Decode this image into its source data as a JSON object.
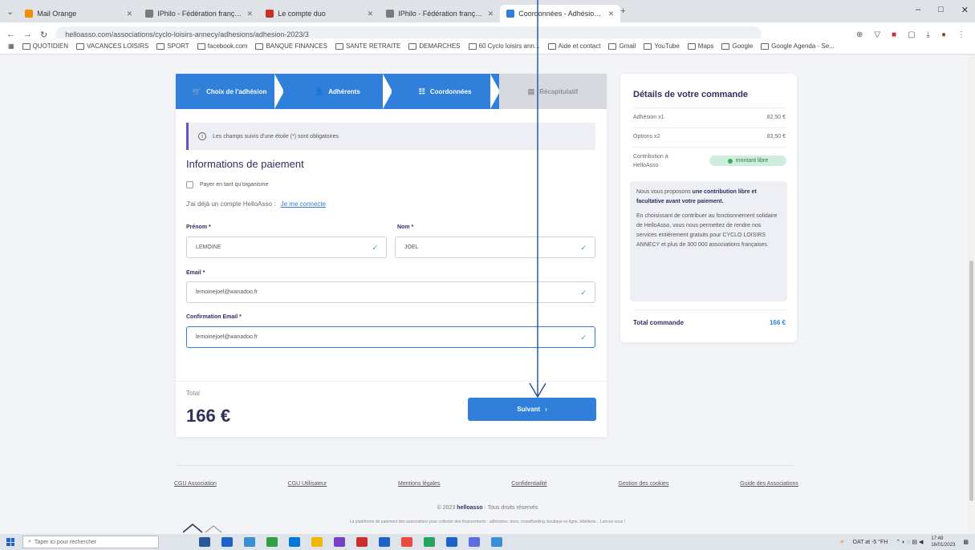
{
  "browser": {
    "tabs": [
      {
        "label": "Mail Orange",
        "color": "#f28c00",
        "active": false
      },
      {
        "label": "IPhilo - Fédération française...",
        "color": "#7a7a7a",
        "active": false
      },
      {
        "label": "Le compte duo",
        "color": "#c9302c",
        "active": false
      },
      {
        "label": "IPhilo - Fédération française...",
        "color": "#7a7a7a",
        "active": false
      },
      {
        "label": "Coordonnées - Adhésion 2023",
        "color": "#2f7fdb",
        "active": true
      }
    ],
    "new_tab": "+",
    "url": "helloasso.com/associations/cyclo-loisirs-annecy/adhesions/adhesion-2023/3",
    "bookmarks": [
      "QUOTIDIEN",
      "VACANCES LOISIRS",
      "SPORT",
      "facebook.com",
      "BANQUE FINANCES",
      "SANTE RETRAITE",
      "DEMARCHES",
      "60 Cyclo loisirs ann...",
      "Aide et contact",
      "Gmail",
      "YouTube",
      "Maps",
      "Google",
      "Google Agenda - Se..."
    ]
  },
  "stepper": {
    "steps": [
      {
        "label": "Choix de l'adhésion",
        "icon": "🛒",
        "state": "done"
      },
      {
        "label": "Adhérents",
        "icon": "👤",
        "state": "done"
      },
      {
        "label": "Coordonnées",
        "icon": "☷",
        "state": "current"
      },
      {
        "label": "Récapitulatif",
        "icon": "▤",
        "state": "future"
      }
    ]
  },
  "form": {
    "notice": "Les champs suivis d'une étoile (*) sont obligatoires",
    "section_title": "Informations de paiement",
    "pay_as_org": "Payer en tant qu'organisme",
    "account_prompt": "J'ai déjà un compte HelloAsso :",
    "login_link": "Je me connecte",
    "prenom_label": "Prénom *",
    "prenom_value": "LEMOINE",
    "nom_label": "Nom *",
    "nom_value": "JOEL",
    "email_label": "Email *",
    "email_value": "lemoinejoel@wanadoo.fr",
    "confirm_label": "Confirmation Email *",
    "confirm_value": "lemoinejoel@wanadoo.fr"
  },
  "total": {
    "label": "Total",
    "value": "166 €",
    "next_button": "Suivant"
  },
  "sidebar": {
    "title": "Détails de votre commande",
    "rows": [
      {
        "label": "Adhésion x1",
        "value": "82,50 €"
      },
      {
        "label": "Options x2",
        "value": "83,50 €"
      }
    ],
    "contribution_label": "Contribution à HelloAsso",
    "contribution_pill": "montant libre",
    "contrib_p1_a": "Nous vous proposons",
    "contrib_p1_b": "une contribution libre et facultative avant votre paiement.",
    "contrib_p2": "En choisissant de contribuer au fonctionnement solidaire de HelloAsso, vous nous permettez de rendre nos services entièrement gratuits pour CYCLO LOISIRS ANNECY et plus de 300 000 associations françaises.",
    "total_label": "Total commande",
    "total_value": "166 €"
  },
  "footer": {
    "links": [
      "CGU Association",
      "CGU Utilisateur",
      "Mentions légales",
      "Confidentialité",
      "Gestion des cookies",
      "Guide des Associations"
    ],
    "copyright_pre": "© 2023",
    "brand": "helloasso",
    "copyright_post": "· Tous droits réservés",
    "footnote": "La plateforme de paiement des associations pour collecter des financements : adhésions, dons, crowdfunding, boutique en ligne, billetterie... Lancez-vous !"
  },
  "taskbar": {
    "search_placeholder": "Taper ici pour rechercher",
    "weather": "OAT at -5 °FH",
    "time": "17:48",
    "date": "16/01/2023",
    "apps": [
      "#2b5797",
      "#1e63c8",
      "#3a8fd6",
      "#2f9e44",
      "#0078d7",
      "#f2b705",
      "#7a3fc7",
      "#c9302c",
      "#1e63c8",
      "#e74c3c",
      "#25a55f",
      "#1e63c8",
      "#5b6ee1",
      "#3a8fd6"
    ]
  },
  "colors": {
    "primary": "#2f7fdb",
    "success": "#3fa96b",
    "notice_accent": "#6a4fc7",
    "text_dark": "#2e2f5e"
  }
}
